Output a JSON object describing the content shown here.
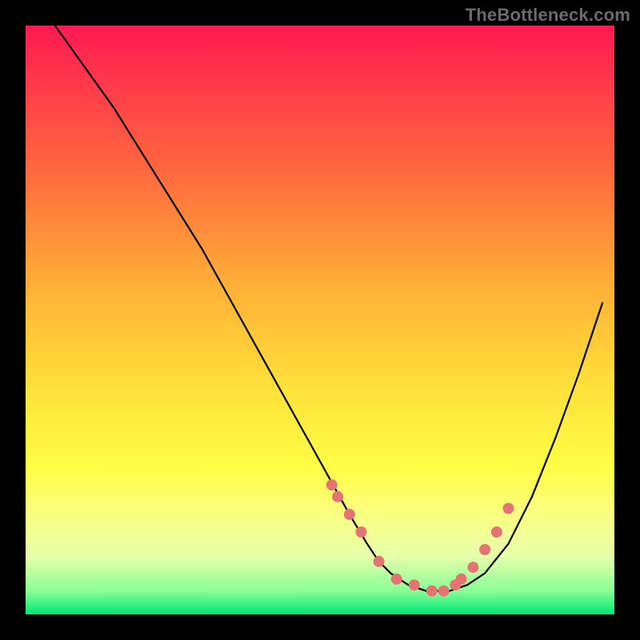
{
  "watermark": "TheBottleneck.com",
  "chart_data": {
    "type": "line",
    "title": "",
    "xlabel": "",
    "ylabel": "",
    "xlim": [
      0,
      100
    ],
    "ylim": [
      0,
      100
    ],
    "grid": false,
    "legend": false,
    "series": [
      {
        "name": "curve",
        "color": "#000000",
        "x": [
          5,
          10,
          15,
          20,
          25,
          30,
          35,
          40,
          45,
          50,
          55,
          58,
          60,
          62,
          65,
          68,
          70,
          72,
          75,
          78,
          82,
          86,
          90,
          94,
          98
        ],
        "y": [
          100,
          93,
          86,
          78,
          70,
          62,
          53,
          44,
          35,
          26,
          17,
          12,
          9,
          7,
          5,
          4,
          4,
          4,
          5,
          7,
          12,
          20,
          30,
          41,
          53
        ]
      }
    ],
    "markers": {
      "name": "dots",
      "color": "#e57373",
      "radius_px": 7,
      "x": [
        52,
        53,
        55,
        57,
        60,
        63,
        66,
        69,
        71,
        73,
        74,
        76,
        78,
        80,
        82
      ],
      "y": [
        22,
        20,
        17,
        14,
        9,
        6,
        5,
        4,
        4,
        5,
        6,
        8,
        11,
        14,
        18
      ]
    }
  }
}
